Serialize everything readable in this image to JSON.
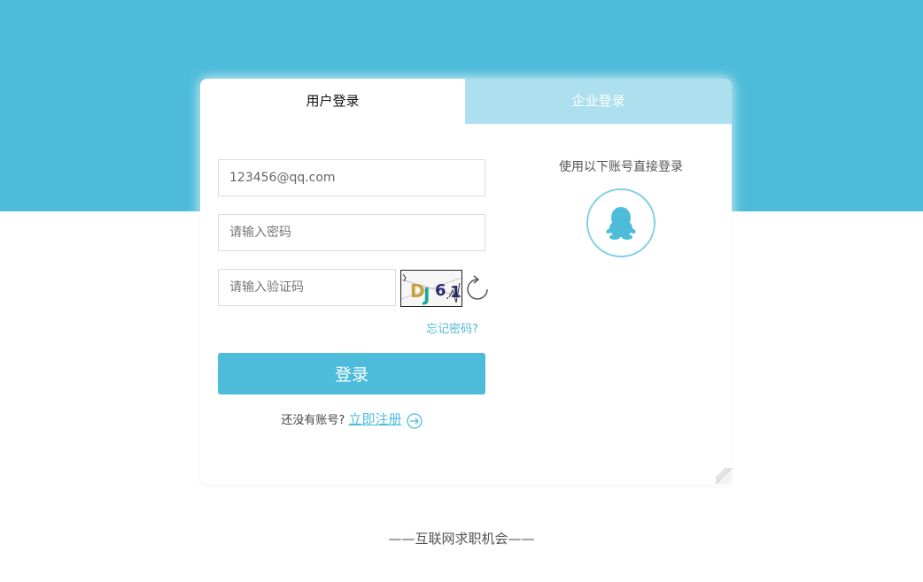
{
  "tabs": {
    "user_login": "用户登录",
    "company_login": "企业登录"
  },
  "form": {
    "email_value": "123456@qq.com",
    "password_placeholder": "请输入密码",
    "captcha_placeholder": "请输入验证码",
    "captcha_text": "DJ6.1",
    "forgot_label": "忘记密码?",
    "login_label": "登录",
    "no_account_text": "还没有账号?",
    "register_label": "立即注册"
  },
  "social": {
    "title": "使用以下账号直接登录",
    "qq_icon": "qq-penguin-icon"
  },
  "footer": {
    "text": "——互联网求职机会——"
  },
  "colors": {
    "primary": "#4dbcda",
    "tab_inactive": "#ace0ee"
  }
}
